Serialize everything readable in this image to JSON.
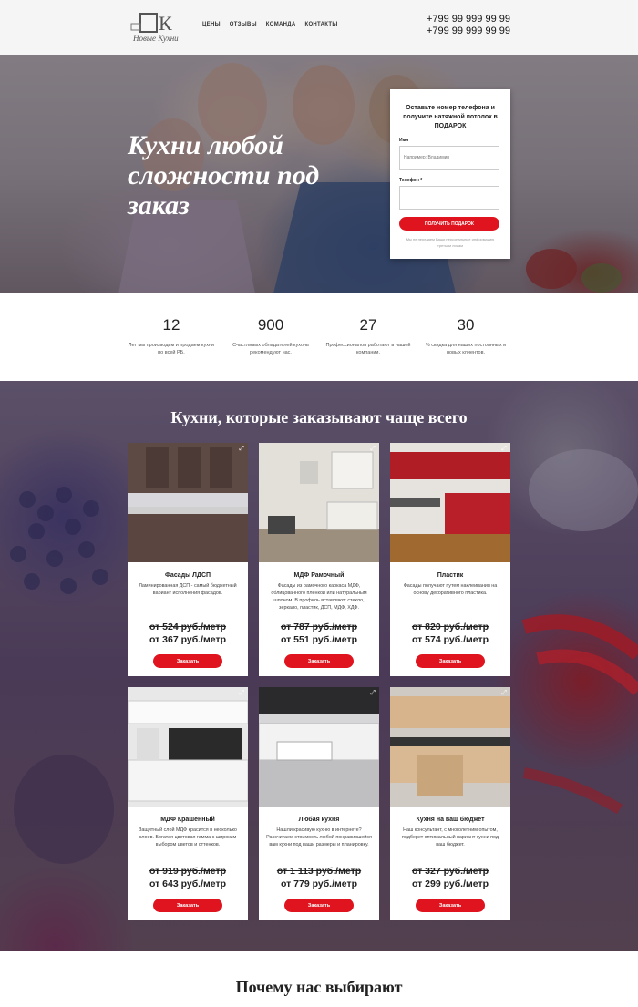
{
  "header": {
    "nav": [
      "ЦЕНЫ",
      "ОТЗЫВЫ",
      "КОМАНДА",
      "КОНТАКТЫ"
    ],
    "phones": [
      "+799 99 999 99 99",
      "+799 99 999 99 99"
    ]
  },
  "hero": {
    "title": "Кухни любой сложности под заказ"
  },
  "form": {
    "title": "Оставьте номер телефона и получите натяжной потолок в ПОДАРОК",
    "name_label": "Имя",
    "name_placeholder": "Например: Владимир",
    "phone_label": "Телефон *",
    "button": "получить подарок",
    "note": "Мы не передаем Ваши персональные информацию третьим лицам"
  },
  "stats": [
    {
      "value": "12",
      "text": "Лет мы производим и продаем кухни по всей РБ."
    },
    {
      "value": "900",
      "text": "Счастливых обладателей кухонь рекомендуют нас."
    },
    {
      "value": "27",
      "text": "Профессионалов работают в нашей компании."
    },
    {
      "value": "30",
      "text": "% скидка для наших постоянных и новых клиентов."
    }
  ],
  "kitchens": {
    "title": "Кухни, которые заказывают чаще всего",
    "button": "Заказать",
    "items": [
      {
        "name": "Фасады ЛДСП",
        "desc": "Ламинированная ДСП - самый бюджетный вариант исполнения фасадов.",
        "old": "от 524 руб./метр",
        "new": "от 367 руб./метр"
      },
      {
        "name": "МДФ Рамочный",
        "desc": "Фасады из рамочного каркаса МДФ, облицованного пленкой или натуральным шпоном. В профиль вставляют: стекло, зеркало, пластик, ДСП, МДФ, ХДФ.",
        "old": "от 787 руб./метр",
        "new": "от 551 руб./метр"
      },
      {
        "name": "Пластик",
        "desc": "Фасады получают путем наклеивания на основу декоративного пластика.",
        "old": "от 820 руб./метр",
        "new": "от 574 руб./метр"
      },
      {
        "name": "МДФ Крашенный",
        "desc": "Защитный слой МДФ красится в несколько слоев. Богатая цветовая гамма с широким выбором цветов и оттенков.",
        "old": "от 919 руб./метр",
        "new": "от 643 руб./метр"
      },
      {
        "name": "Любая кухня",
        "desc": "Нашли красивую кухню в интернете? Рассчитаем стоимость любой понравившейся вам кухни под ваши размеры и планировку.",
        "old": "от 1 113 руб./метр",
        "new": "от 779 руб./метр"
      },
      {
        "name": "Кухня на ваш бюджет",
        "desc": "Наш консультант, с многолетним опытом, подберет оптимальный вариант кухни под ваш бюджет.",
        "old": "от 327 руб./метр",
        "new": "от 299 руб./метр"
      }
    ]
  },
  "why": {
    "title": "Почему нас выбирают"
  }
}
